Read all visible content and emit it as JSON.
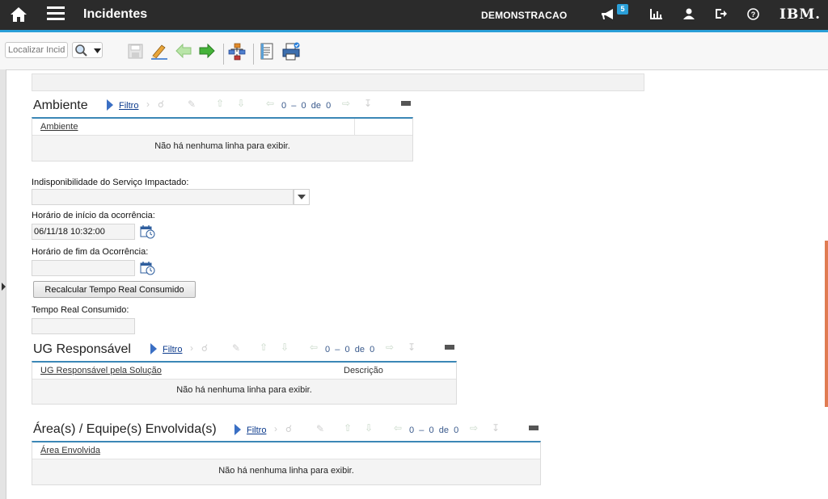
{
  "header": {
    "app_title": "Incidentes",
    "user": "DEMONSTRACAO",
    "notification_count": "5",
    "brand": "IBM.",
    "accent_color": "#2a9fd8"
  },
  "toolbar": {
    "search_placeholder": "Localizar Incide"
  },
  "ambiente": {
    "title": "Ambiente",
    "filter_label": "Filtro",
    "pager": {
      "from": "0",
      "sep": "–",
      "to": "0",
      "of_label": "de",
      "total": "0"
    },
    "columns": [
      "Ambiente"
    ],
    "empty_text": "Não há nenhuma linha para exibir."
  },
  "form": {
    "indisponibilidade_label": "Indisponibilidade do Serviço Impactado:",
    "indisponibilidade_value": "",
    "inicio_label": "Horário de início da ocorrência:",
    "inicio_value": "06/11/18 10:32:00",
    "fim_label": "Horário de fim da Ocorrência:",
    "fim_value": "",
    "recalc_button": "Recalcular Tempo Real Consumido",
    "tempo_label": "Tempo Real Consumido:",
    "tempo_value": ""
  },
  "ug": {
    "title": "UG Responsável",
    "filter_label": "Filtro",
    "pager": {
      "from": "0",
      "sep": "–",
      "to": "0",
      "of_label": "de",
      "total": "0"
    },
    "columns": [
      "UG Responsável pela Solução",
      "Descrição"
    ],
    "empty_text": "Não há nenhuma linha para exibir."
  },
  "areas": {
    "title": "Área(s) / Equipe(s) Envolvida(s)",
    "filter_label": "Filtro",
    "pager": {
      "from": "0",
      "sep": "–",
      "to": "0",
      "of_label": "de",
      "total": "0"
    },
    "columns": [
      "Área Envolvida"
    ],
    "empty_text": "Não há nenhuma linha para exibir."
  }
}
